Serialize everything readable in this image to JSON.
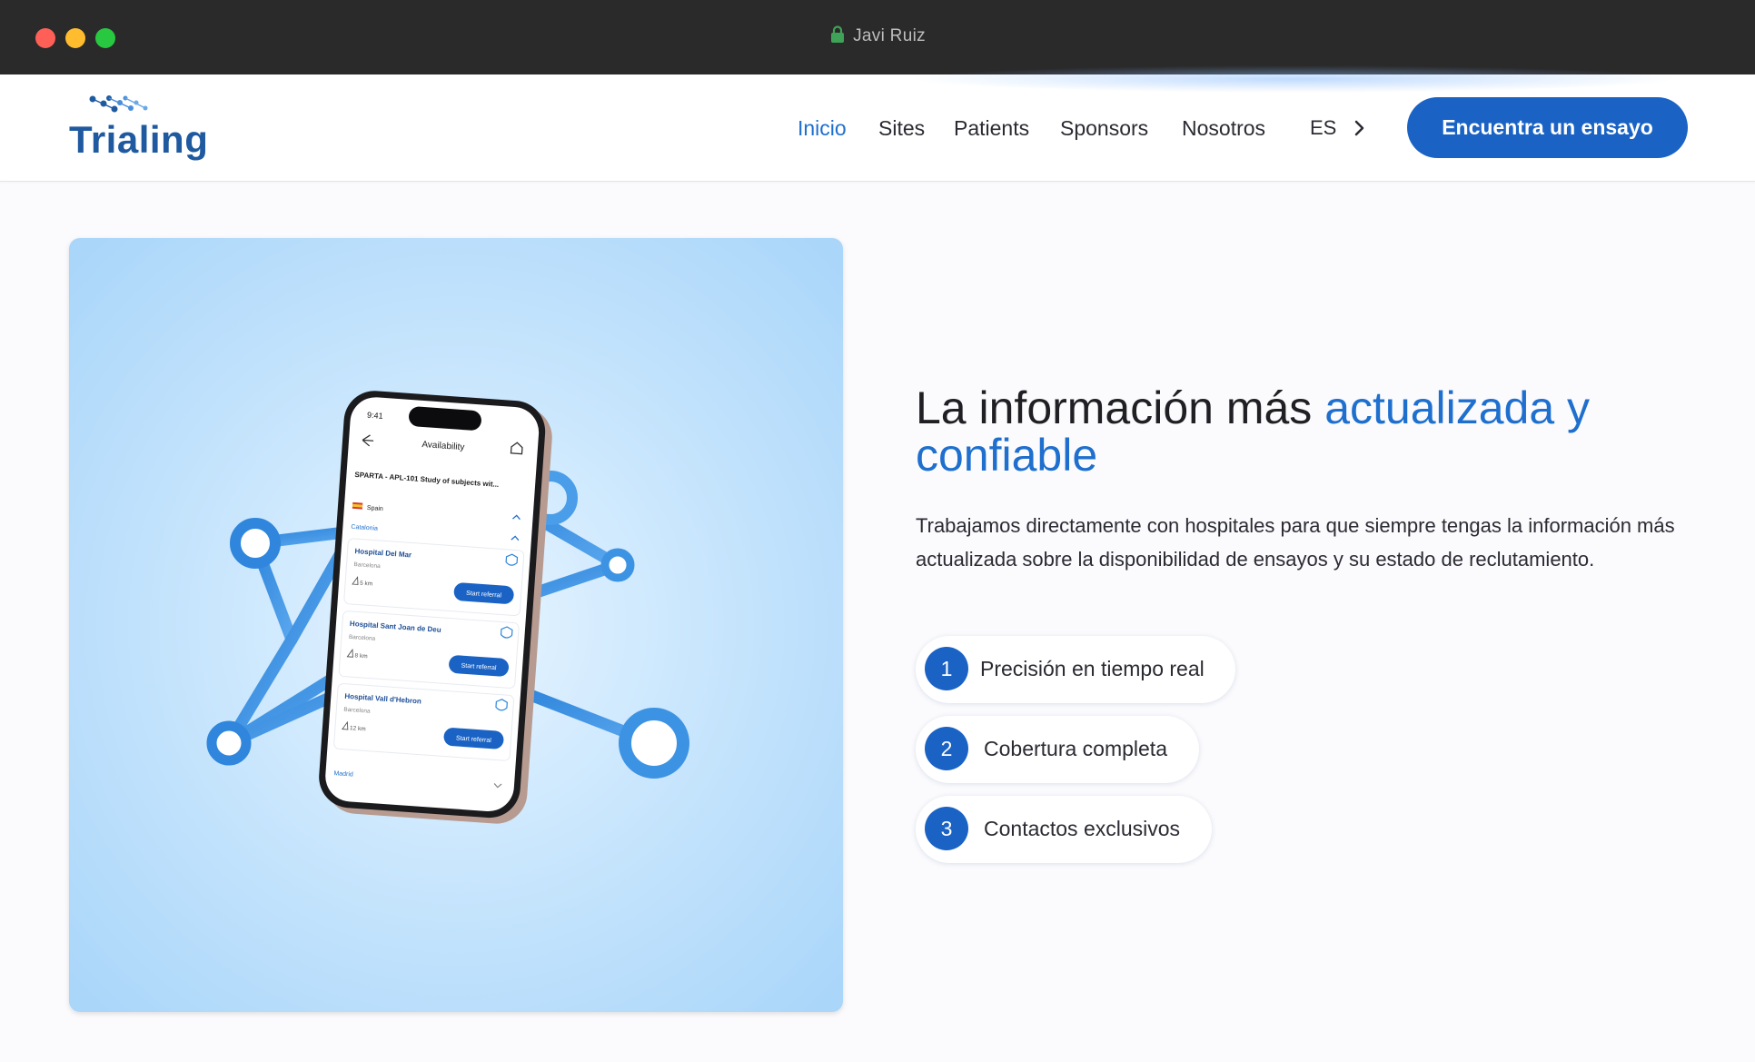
{
  "window": {
    "title": "Javi Ruiz"
  },
  "header": {
    "logo_text": "Trialing",
    "nav": [
      {
        "label": "Inicio",
        "active": true
      },
      {
        "label": "Sites",
        "active": false
      },
      {
        "label": "Patients",
        "active": false
      },
      {
        "label": "Sponsors",
        "active": false
      },
      {
        "label": "Nosotros",
        "active": false
      }
    ],
    "language": "ES",
    "cta_label": "Encuentra un ensayo"
  },
  "hero": {
    "headline_plain": "La información más ",
    "headline_accent": "actualizada y confiable",
    "description": "Trabajamos directamente con hospitales para que siempre tengas la información más actualizada sobre la disponibilidad de ensayos y su estado de reclutamiento.",
    "features": [
      {
        "number": "1",
        "label": "Precisión en tiempo real"
      },
      {
        "number": "2",
        "label": "Cobertura completa"
      },
      {
        "number": "3",
        "label": "Contactos exclusivos"
      }
    ]
  },
  "phone": {
    "time": "9:41",
    "screen_title": "Availability",
    "study": "SPARTA - APL-101 Study of subjects wit...",
    "country": "Spain",
    "region": "Catalonia",
    "hospitals": [
      {
        "name": "Hospital Del Mar",
        "city": "Barcelona",
        "distance": "5 km",
        "button": "Start referral"
      },
      {
        "name": "Hospital Sant Joan de Deu",
        "city": "Barcelona",
        "distance": "8 km",
        "button": "Start referral"
      },
      {
        "name": "Hospital Vall d'Hebron",
        "city": "Barcelona",
        "distance": "12 km",
        "button": "Start referral"
      }
    ],
    "next_region": "Madrid"
  },
  "colors": {
    "accent": "#1e6fce",
    "cta": "#1a63c4",
    "titlebar": "#2a2a2b"
  }
}
